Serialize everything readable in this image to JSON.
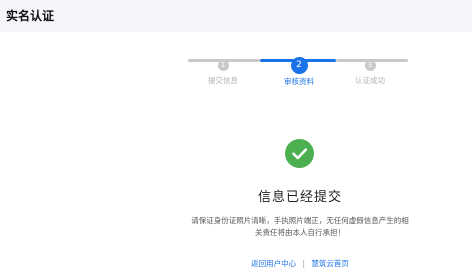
{
  "header": {
    "title": "实名认证"
  },
  "steps": [
    {
      "number": "1",
      "label": "提交信息",
      "state": "done"
    },
    {
      "number": "2",
      "label": "审核资料",
      "state": "current"
    },
    {
      "number": "3",
      "label": "认证成功",
      "state": "todo"
    }
  ],
  "result": {
    "icon": "check-circle-icon",
    "icon_color": "#4caf50",
    "title": "信息已经提交",
    "description_line1": "请保证身份证照片清晰，手执照片端正，无任何虚假信息产生的相",
    "description_line2": "关责任将由本人自行承担！"
  },
  "links": {
    "user_center": "返回用户中心",
    "separator": "|",
    "home": "慧筑云首页"
  },
  "colors": {
    "accent": "#1a73e8",
    "inactive": "#c9c9c9",
    "success": "#4caf50",
    "header_bg": "#f4f6fb"
  }
}
